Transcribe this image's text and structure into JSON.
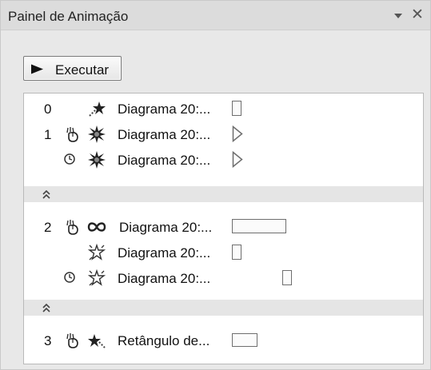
{
  "pane": {
    "title": "Painel de Animação",
    "menu_icon": "dropdown-arrow-icon",
    "close_icon": "close-icon"
  },
  "play_button": {
    "label": "Executar",
    "icon": "play-triangle-icon"
  },
  "animation_list": {
    "rows": [
      {
        "order": "0",
        "trigger": "none",
        "effect_icon": "star-entrance-icon",
        "label": "Diagrama 20:..."
      },
      {
        "order": "1",
        "trigger": "on-click-mouse-icon",
        "effect_icon": "burst-emphasis-icon",
        "label": "Diagrama 20:..."
      },
      {
        "order": "",
        "trigger": "after-previous-clock-icon",
        "effect_icon": "burst-emphasis-icon",
        "label": "Diagrama 20:..."
      },
      {
        "order": "2",
        "trigger": "on-click-mouse-icon",
        "effect_icon": "motion-path-loop-icon",
        "label": "Diagrama 20:..."
      },
      {
        "order": "",
        "trigger": "none",
        "effect_icon": "sparkle-star-icon",
        "label": "Diagrama 20:..."
      },
      {
        "order": "",
        "trigger": "after-previous-clock-icon",
        "effect_icon": "sparkle-star-icon",
        "label": "Diagrama 20:..."
      },
      {
        "order": "3",
        "trigger": "on-click-mouse-icon",
        "effect_icon": "star-exit-icon",
        "label": "Retângulo de..."
      }
    ],
    "separators": [
      {
        "icon": "collapse-chevron-icon"
      },
      {
        "icon": "collapse-chevron-icon"
      }
    ]
  },
  "colors": {
    "pane_bg": "#e8e8e8",
    "list_bg": "#ffffff",
    "separator_bg": "#e5e5e5",
    "timing_border": "#6e6e6e"
  }
}
